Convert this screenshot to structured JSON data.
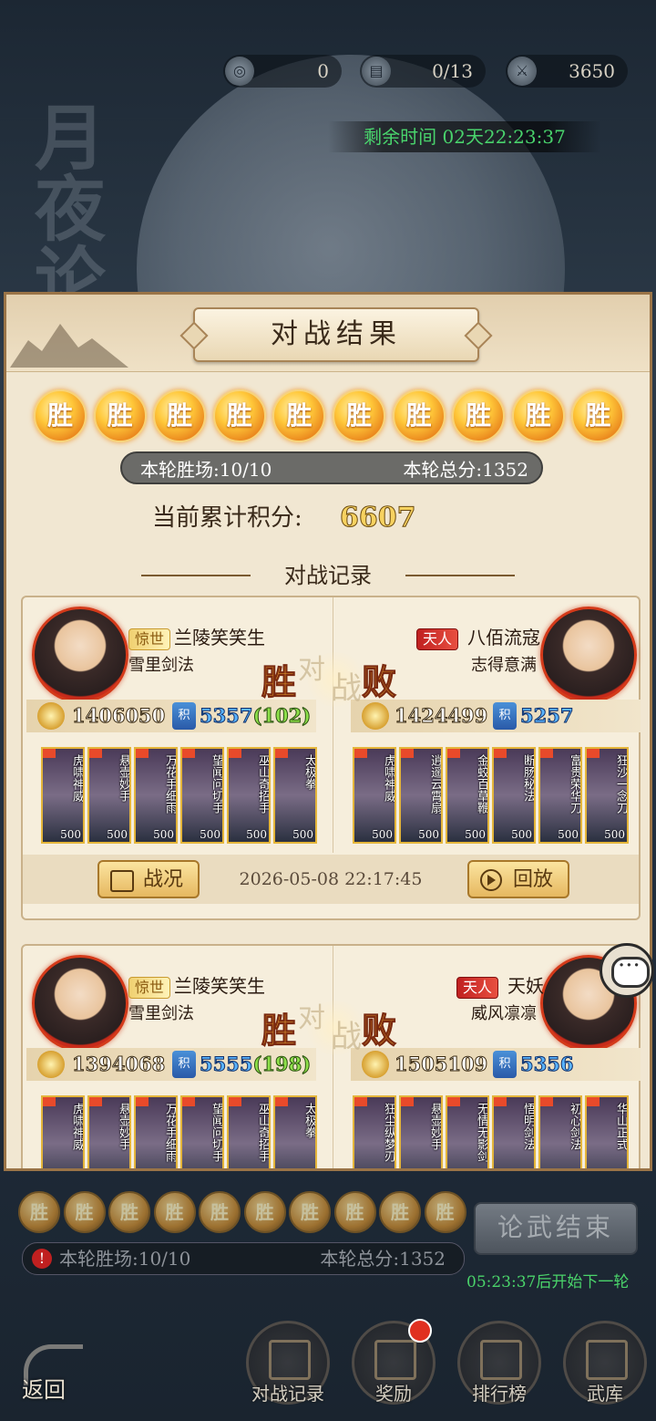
{
  "top": {
    "res1": "0",
    "res2": "0/13",
    "res3": "3650",
    "timer_label": "剩余时间",
    "timer_value": "02天22:23:37"
  },
  "bg_title": "月夜论",
  "panel": {
    "title": "对战结果",
    "win_char": "胜",
    "win_count": 10,
    "round_wins": "本轮胜场:10/10",
    "round_total": "本轮总分:1352",
    "cumulative_label": "当前累计积分:",
    "cumulative_value": "6607",
    "section_title": "对战记录"
  },
  "battles": [
    {
      "left": {
        "rank": "惊世",
        "name": "兰陵笑笑生",
        "sub": "雪里剑法",
        "power": "1406050",
        "score": "5357",
        "score_plus": "(102)",
        "cards": [
          "虎啸神威",
          "悬壶妙手",
          "万花手细雨",
          "望闻问切手",
          "巫山奇招手",
          "太极拳"
        ]
      },
      "right": {
        "rank": "天人",
        "name": "八佰流寇",
        "sub": "志得意满",
        "power": "1424499",
        "score": "5257",
        "cards": [
          "虎啸神威",
          "逍遥云霄扇",
          "金蛟百草鞭",
          "断肠秘法",
          "富贵荣华刀",
          "狂沙一念刀"
        ]
      },
      "vs": {
        "win": "胜",
        "dui": "对",
        "zhan": "战",
        "lose": "败"
      },
      "card_level": "500",
      "report_label": "战况",
      "date": "2026-05-08 22:17:45",
      "replay_label": "回放"
    },
    {
      "left": {
        "rank": "惊世",
        "name": "兰陵笑笑生",
        "sub": "雪里剑法",
        "power": "1394068",
        "score": "5555",
        "score_plus": "(198)",
        "cards": [
          "虎啸神威",
          "悬壶妙手",
          "万花手细雨",
          "望闻问切手",
          "巫山奇招手",
          "太极拳"
        ]
      },
      "right": {
        "rank": "天人",
        "name": "天妖",
        "sub": "威风凛凛",
        "power": "1505109",
        "score": "5356",
        "cards": [
          "狂尘纵梦刃",
          "悬壶妙手",
          "无情无影剑",
          "悟明剑法",
          "初心剑法",
          "华山正式"
        ]
      },
      "vs": {
        "win": "胜",
        "dui": "对",
        "zhan": "战",
        "lose": "败"
      }
    }
  ],
  "bottom": {
    "win_char": "胜",
    "end_button": "论武结束",
    "round_wins": "本轮胜场:10/10",
    "round_total": "本轮总分:1352",
    "next_round": "05:23:37后开始下一轮",
    "nav": [
      "对战记录",
      "奖励",
      "排行榜",
      "武库"
    ],
    "back": "返回"
  },
  "colors": {
    "accent_green": "#49d36c",
    "win_gold": "#ffc83a",
    "tian_red": "#c02020"
  }
}
